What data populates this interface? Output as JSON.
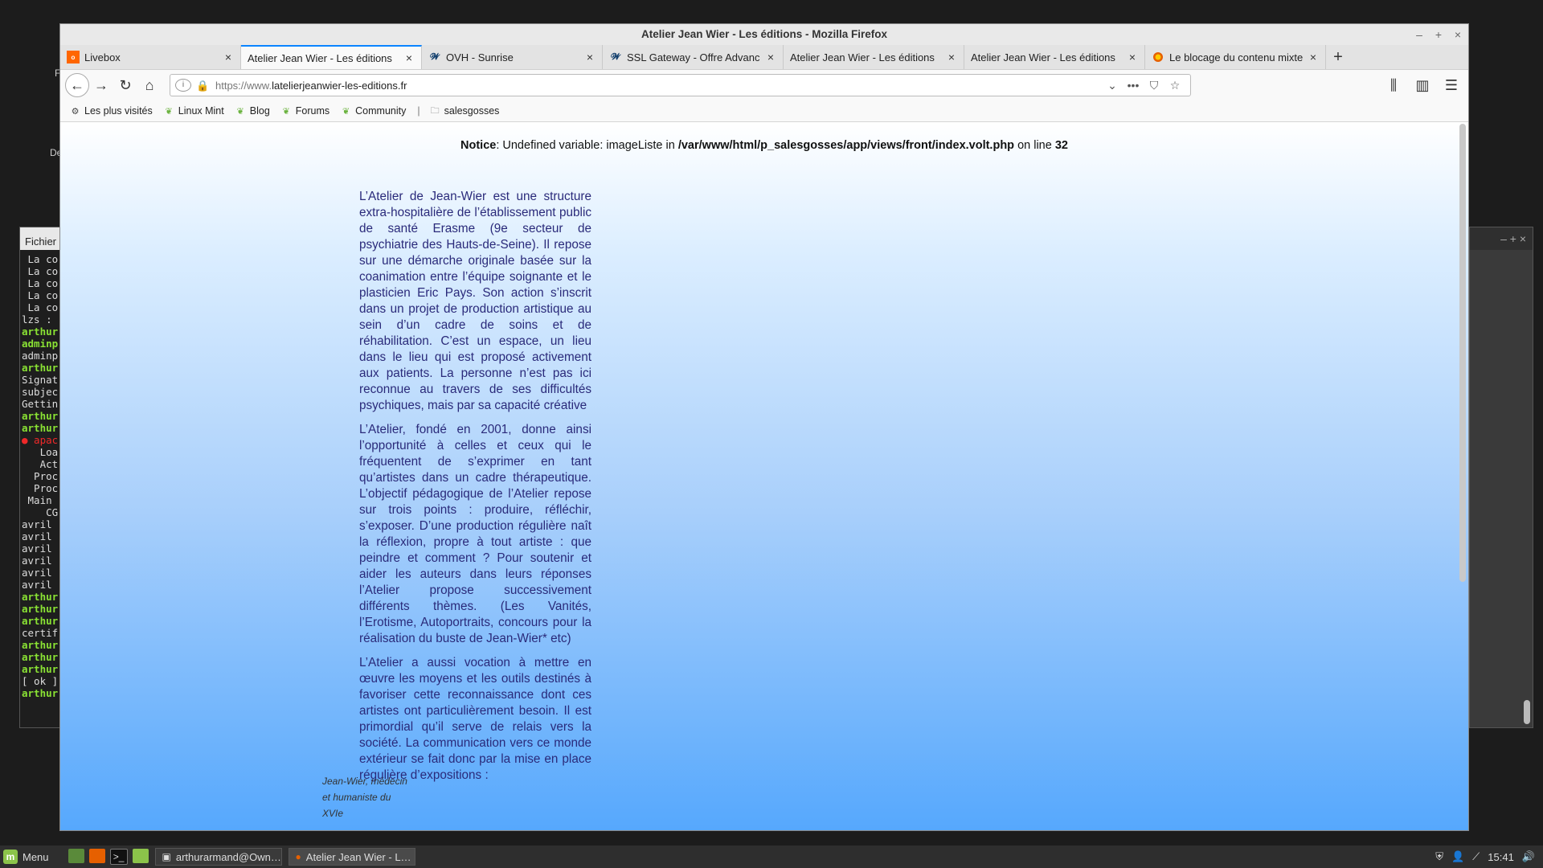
{
  "window": {
    "title": "Atelier Jean Wier - Les éditions - Mozilla Firefox",
    "controls": [
      "–",
      "+",
      "×"
    ]
  },
  "tabs": [
    {
      "title": "Livebox",
      "icon": "orange-icon",
      "color": "#ff6600"
    },
    {
      "title": "Atelier Jean Wier - Les éditions",
      "icon": "none",
      "active": true
    },
    {
      "title": "OVH - Sunrise",
      "icon": "ovh-icon",
      "color": "#123f6d"
    },
    {
      "title": "SSL Gateway - Offre Advance",
      "icon": "ovh-icon",
      "color": "#123f6d"
    },
    {
      "title": "Atelier Jean Wier - Les éditions",
      "icon": "none"
    },
    {
      "title": "Atelier Jean Wier - Les éditions",
      "icon": "none"
    },
    {
      "title": "Le blocage du contenu mixte",
      "icon": "firefox-icon",
      "color": "#e66000"
    }
  ],
  "newtab_label": "+",
  "urlbar": {
    "prefix": "https://www.",
    "domain": "latelierjeanwier-les-editions.fr"
  },
  "bookmarks": [
    {
      "label": "Les plus visités",
      "icon": "gear-icon"
    },
    {
      "label": "Linux Mint",
      "icon": "leaf-icon"
    },
    {
      "label": "Blog",
      "icon": "leaf-icon"
    },
    {
      "label": "Forums",
      "icon": "leaf-icon"
    },
    {
      "label": "Community",
      "icon": "leaf-icon"
    },
    {
      "label": "salesgosses",
      "icon": "folder-icon"
    }
  ],
  "bookmark_separator": "|",
  "page": {
    "notice_label": "Notice",
    "notice_text": ": Undefined variable: imageListe in ",
    "notice_path": "/var/www/html/p_salesgosses/app/views/front/index.volt.php",
    "notice_mid": " on line ",
    "notice_line": "32",
    "paragraphs": [
      "L’Atelier de Jean-Wier est une structure extra-hospitalière de l’établissement public de santé Erasme (9e secteur de psychiatrie des Hauts-de-Seine). Il repose sur une démarche originale basée sur la coanimation entre l’équipe soignante et le plasticien Eric Pays. Son action s’inscrit dans un projet de production artistique au sein d’un cadre de soins et de réhabilitation. C’est un espace, un lieu dans le lieu qui est proposé activement aux patients. La personne n’est pas ici reconnue au travers de ses difficultés psychiques, mais par sa capacité créative",
      "L’Atelier, fondé en 2001, donne ainsi l’opportunité à celles et ceux qui le fréquentent de s’exprimer en tant qu’artistes dans un cadre thérapeutique. L’objectif pédagogique de l’Atelier repose sur trois points : produire, réfléchir, s’exposer. D’une production régulière naît la réflexion, propre à tout artiste : que peindre et comment ? Pour soutenir et aider les auteurs dans leurs réponses l’Atelier propose successivement différents thèmes. (Les Vanités, l’Erotisme, Autoportraits, concours pour la réalisation du buste de Jean-Wier* etc)",
      "L’Atelier a aussi vocation à mettre en œuvre les moyens et les outils destinés à favoriser cette reconnaissance dont ces artistes ont particulièrement besoin. Il est primordial qu’il serve de relais vers la société. La communication vers ce monde extérieur se fait donc par la mise en place régulière d’expositions :"
    ],
    "caption": "Jean-Wier, médecin et humaniste du XVIe"
  },
  "terminal": {
    "menu": "Fichier",
    "lines": [
      {
        "t": " La co",
        "c": ""
      },
      {
        "t": " La co",
        "c": ""
      },
      {
        "t": " La co",
        "c": ""
      },
      {
        "t": " La co",
        "c": ""
      },
      {
        "t": " La co",
        "c": ""
      },
      {
        "t": "lzs :",
        "c": ""
      },
      {
        "t": "arthur",
        "c": "g"
      },
      {
        "t": "adminp",
        "c": "g"
      },
      {
        "t": "adminp",
        "c": ""
      },
      {
        "t": "arthur",
        "c": "g"
      },
      {
        "t": "Signat",
        "c": ""
      },
      {
        "t": "subjec",
        "c": ""
      },
      {
        "t": "Gettin",
        "c": ""
      },
      {
        "t": "arthur",
        "c": "g"
      },
      {
        "t": "arthur",
        "c": "g"
      },
      {
        "t": "● apac",
        "c": "r"
      },
      {
        "t": "   Loa",
        "c": ""
      },
      {
        "t": "   Act",
        "c": ""
      },
      {
        "t": "  Proc",
        "c": ""
      },
      {
        "t": "  Proc",
        "c": ""
      },
      {
        "t": " Main",
        "c": ""
      },
      {
        "t": "    CGr",
        "c": ""
      },
      {
        "t": "",
        "c": ""
      },
      {
        "t": "avril",
        "c": ""
      },
      {
        "t": "avril",
        "c": ""
      },
      {
        "t": "avril",
        "c": ""
      },
      {
        "t": "avril",
        "c": ""
      },
      {
        "t": "avril",
        "c": ""
      },
      {
        "t": "avril",
        "c": ""
      },
      {
        "t": "arthur",
        "c": "g"
      },
      {
        "t": "arthur",
        "c": "g"
      },
      {
        "t": "arthur",
        "c": "g"
      },
      {
        "t": "certif",
        "c": ""
      },
      {
        "t": "arthur",
        "c": "g"
      },
      {
        "t": "arthur",
        "c": "g"
      },
      {
        "t": "arthur",
        "c": "g"
      },
      {
        "t": "[ ok ]",
        "c": ""
      },
      {
        "t": "arthur",
        "c": "g"
      }
    ]
  },
  "desktop_frag_1": "F",
  "desktop_frag_2": "De",
  "right_window_controls": "– + ×",
  "taskbar": {
    "menu_label": "Menu",
    "tasks": [
      {
        "label": "arthurarmand@Own…",
        "icon": "terminal-icon"
      },
      {
        "label": "Atelier Jean Wier - L…",
        "icon": "firefox-icon",
        "active": true
      }
    ],
    "clock": "15:41"
  }
}
